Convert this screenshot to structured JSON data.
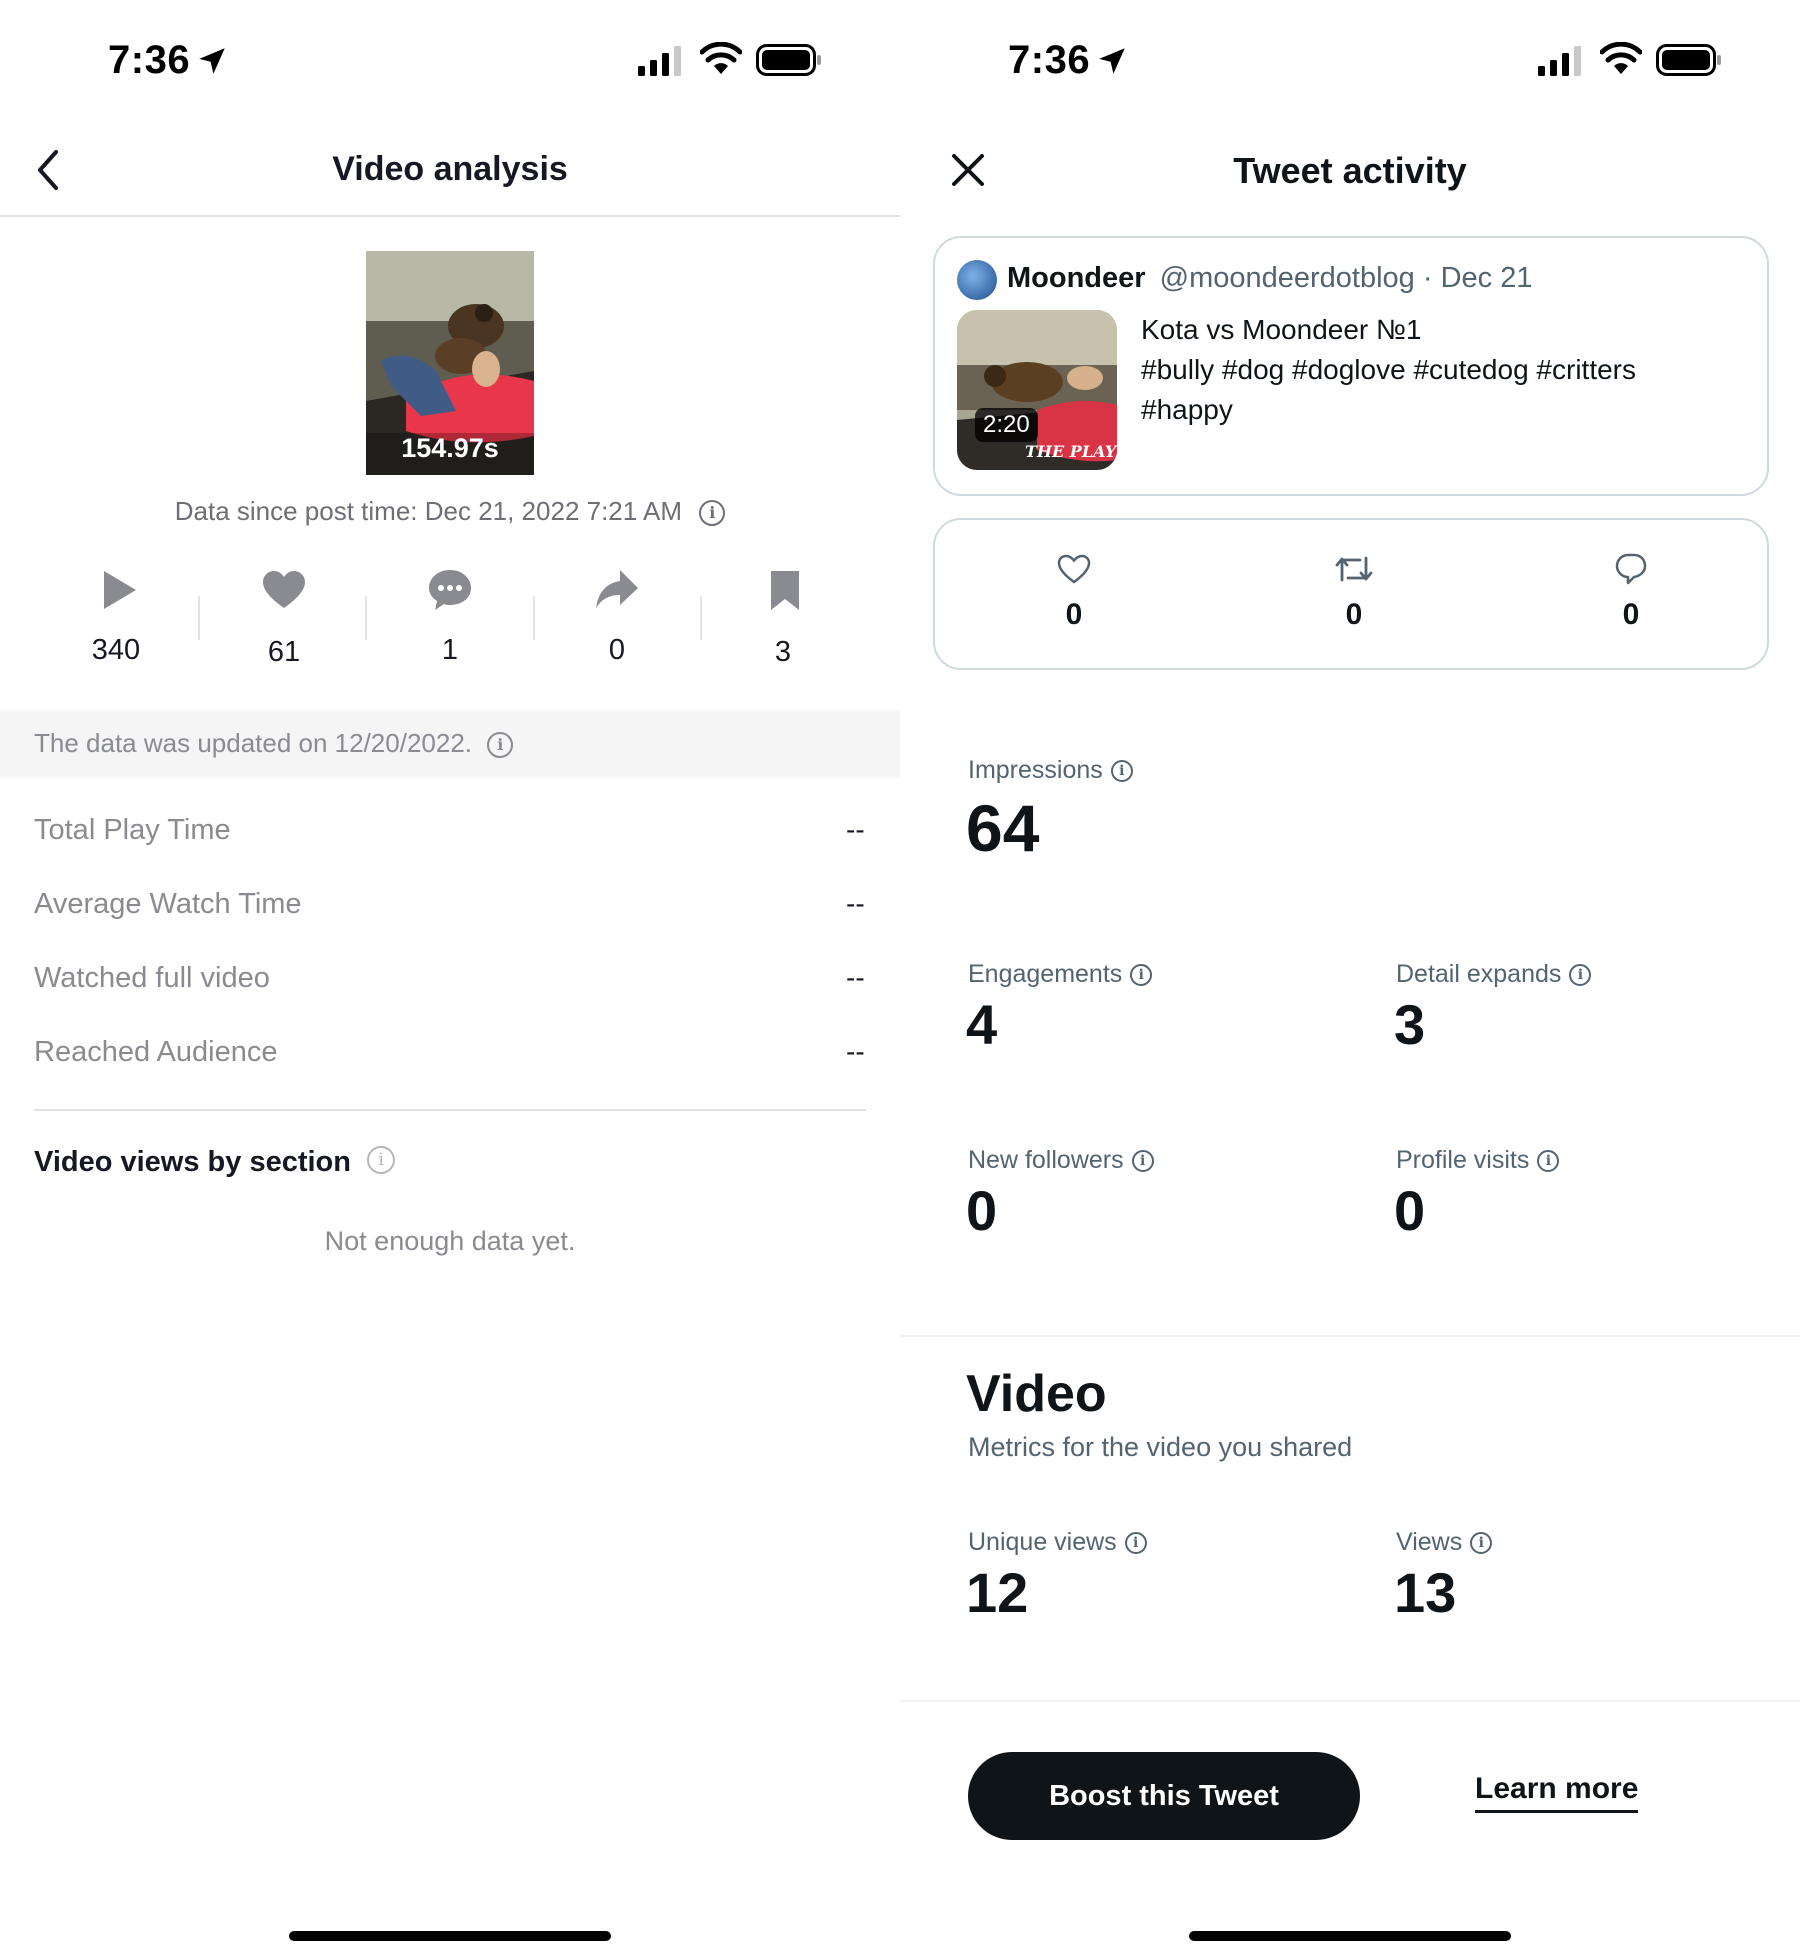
{
  "left": {
    "status": {
      "time": "7:36"
    },
    "nav": {
      "title": "Video analysis"
    },
    "thumbnail": {
      "duration": "154.97s"
    },
    "data_since": "Data since post time: Dec 21, 2022 7:21 AM",
    "stats": [
      {
        "icon": "play-icon",
        "value": "340"
      },
      {
        "icon": "heart-icon",
        "value": "61"
      },
      {
        "icon": "comment-icon",
        "value": "1"
      },
      {
        "icon": "share-icon",
        "value": "0"
      },
      {
        "icon": "bookmark-icon",
        "value": "3"
      }
    ],
    "updated_banner": "The data was updated on 12/20/2022.",
    "metrics": [
      {
        "label": "Total Play Time",
        "value": "--"
      },
      {
        "label": "Average Watch Time",
        "value": "--"
      },
      {
        "label": "Watched full video",
        "value": "--"
      },
      {
        "label": "Reached Audience",
        "value": "--"
      }
    ],
    "section_title": "Video views by section",
    "empty_text": "Not enough data yet."
  },
  "right": {
    "status": {
      "time": "7:36"
    },
    "nav": {
      "title": "Tweet activity"
    },
    "tweet": {
      "display_name": "Moondeer",
      "handle_date": "@moondeerdotblog · Dec 21",
      "text_line1": "Kota vs Moondeer №1",
      "text_line2": "#bully #dog #doglove #cutedog #critters",
      "text_line3": "#happy",
      "video_duration": "2:20",
      "video_watermark": "THE PLAYFUL"
    },
    "engagement_counts": [
      {
        "icon": "heart-outline-icon",
        "value": "0"
      },
      {
        "icon": "retweet-icon",
        "value": "0"
      },
      {
        "icon": "reply-icon",
        "value": "0"
      }
    ],
    "impressions": {
      "label": "Impressions",
      "value": "64"
    },
    "engagements": {
      "label": "Engagements",
      "value": "4"
    },
    "detail_expands": {
      "label": "Detail expands",
      "value": "3"
    },
    "new_followers": {
      "label": "New followers",
      "value": "0"
    },
    "profile_visits": {
      "label": "Profile visits",
      "value": "0"
    },
    "video": {
      "title": "Video",
      "subtitle": "Metrics for the video you shared",
      "unique_views": {
        "label": "Unique views",
        "value": "12"
      },
      "views": {
        "label": "Views",
        "value": "13"
      }
    },
    "actions": {
      "boost_label": "Boost this Tweet",
      "learn_more_label": "Learn more"
    }
  },
  "colors": {
    "tiktok_text": "#161823",
    "tiktok_muted": "#8a8b91",
    "twitter_text": "#0f1419",
    "twitter_muted": "#536471",
    "boost_bg": "#0f1419"
  }
}
